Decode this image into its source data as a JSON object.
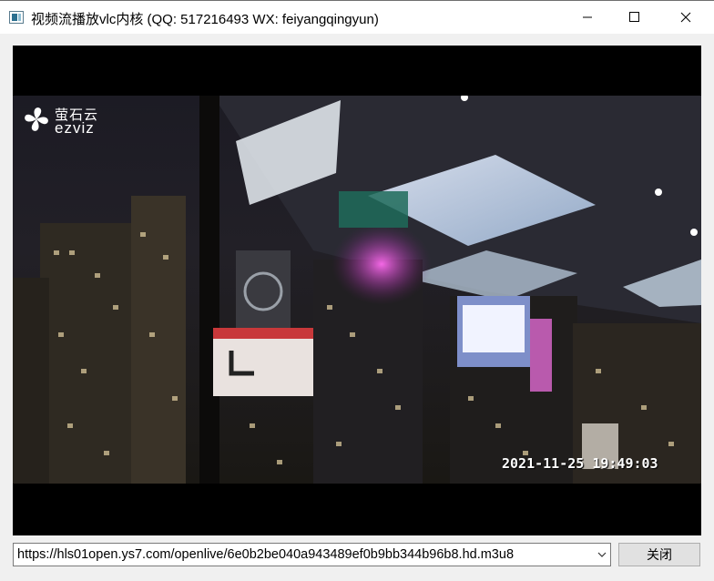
{
  "window": {
    "title": "视频流播放vlc内核 (QQ: 517216493 WX: feiyangqingyun)"
  },
  "video": {
    "logo_cn": "萤石云",
    "logo_en": "ezviz",
    "osd_timestamp": "2021-11-25 19:49:03"
  },
  "controls": {
    "url_value": "https://hls01open.ys7.com/openlive/6e0b2be040a943489ef0b9bb344b96b8.hd.m3u8",
    "close_label": "关闭"
  },
  "icons": {
    "app": "app-window-icon",
    "minimize": "minimize-icon",
    "maximize": "maximize-icon",
    "close": "close-icon",
    "dropdown": "chevron-down-icon",
    "logo": "ezviz-logo-icon"
  }
}
